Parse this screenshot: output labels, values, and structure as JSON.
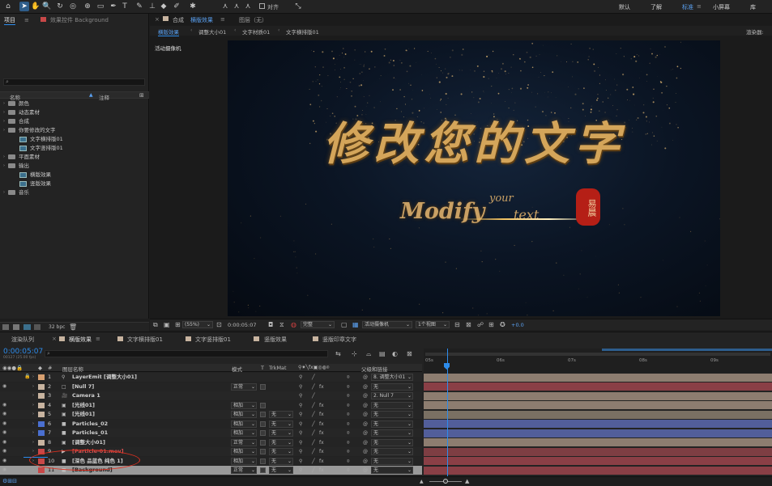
{
  "menu": {
    "workspaces": [
      "默认",
      "了解",
      "标准",
      "小屏幕",
      "库"
    ],
    "active_workspace": "标准",
    "align_label": "对齐"
  },
  "project": {
    "tab_label": "项目",
    "effects_tab_label": "效果控件 Background",
    "search_placeholder": "",
    "col_name": "名称",
    "col_comment": "注释",
    "bpc": "32 bpc",
    "tree": [
      {
        "label": "颜色",
        "type": "folder",
        "indent": 0
      },
      {
        "label": "动态素材",
        "type": "folder",
        "indent": 0
      },
      {
        "label": "合成",
        "type": "folder",
        "indent": 0
      },
      {
        "label": "你要修改的文字",
        "type": "folder",
        "indent": 0
      },
      {
        "label": "文字横排版01",
        "type": "comp",
        "indent": 1
      },
      {
        "label": "文字竖排版01",
        "type": "comp",
        "indent": 1
      },
      {
        "label": "平面素材",
        "type": "folder",
        "indent": 0
      },
      {
        "label": "输出",
        "type": "folder",
        "indent": 0
      },
      {
        "label": "横版效果",
        "type": "comp",
        "indent": 1
      },
      {
        "label": "竖版效果",
        "type": "comp",
        "indent": 1
      },
      {
        "label": "音乐",
        "type": "folder",
        "indent": 0
      }
    ]
  },
  "comp": {
    "header_prefix": "合成",
    "header_name": "横版效果",
    "layer_label": "图层（无）",
    "breadcrumbs": [
      "横版效果",
      "调整大小01",
      "文字材质01",
      "文字横排版01"
    ],
    "renderer_label": "渲染器:",
    "camera_label": "活动摄像机",
    "title_cn": "修改您的文字",
    "title_en": "Modify",
    "title_en2": "your",
    "title_en3": "text",
    "seal_text": "易晨",
    "zoom": "(55%)",
    "timecode": "0:00:05:07",
    "quality": "完整",
    "view_camera": "活动摄像机",
    "view_count": "1个视图",
    "exposure": "+0.0"
  },
  "timeline": {
    "tabs": [
      "渲染队列",
      "横版效果",
      "文字横排版01",
      "文字竖排版01",
      "竖版效果",
      "竖版印章文字"
    ],
    "active_tab": "横版效果",
    "timecode": "0:00:05:07",
    "fps": "00127 (25.00 fps)",
    "col_hash": "#",
    "col_name": "图层名称",
    "col_mode": "模式",
    "col_t": "T",
    "col_trkmat": "TrkMat",
    "col_parent": "父级和链接",
    "ruler": [
      "05s",
      "06s",
      "07s",
      "08s",
      "09s"
    ],
    "layers": [
      {
        "num": "1",
        "name": "LayerEmit [调整大小01]",
        "color": "#d8a070",
        "mode": "",
        "trk": "",
        "parent": "8. 调整大小01",
        "bar": "#8d7d70",
        "icon": "emit"
      },
      {
        "num": "2",
        "name": "[Null 7]",
        "color": "#c8b4a0",
        "mode": "正常",
        "trk": "",
        "parent": "无",
        "bar": "#8a3f46",
        "icon": "null"
      },
      {
        "num": "3",
        "name": "Camera 1",
        "color": "#c8b4a0",
        "mode": "",
        "trk": "",
        "parent": "2. Null 7",
        "bar": "#8d7d70",
        "icon": "camera"
      },
      {
        "num": "4",
        "name": "[光线01]",
        "color": "#c8b4a0",
        "mode": "相加",
        "trk": "",
        "parent": "无",
        "bar": "#8d7d70",
        "icon": "comp"
      },
      {
        "num": "5",
        "name": "[光线01]",
        "color": "#c8b4a0",
        "mode": "相加",
        "trk": "无",
        "parent": "无",
        "bar": "#7a7063",
        "icon": "comp"
      },
      {
        "num": "6",
        "name": "Particles_02",
        "color": "#4a6fd0",
        "mode": "相加",
        "trk": "无",
        "parent": "无",
        "bar": "#525e9a",
        "icon": "solid"
      },
      {
        "num": "7",
        "name": "Particles_01",
        "color": "#4a6fd0",
        "mode": "相加",
        "trk": "无",
        "parent": "无",
        "bar": "#525e9a",
        "icon": "solid"
      },
      {
        "num": "8",
        "name": "[调整大小01]",
        "color": "#c8b4a0",
        "mode": "正常",
        "trk": "无",
        "parent": "无",
        "bar": "#8d7d70",
        "icon": "comp"
      },
      {
        "num": "9",
        "name": "[Particle-01.mov]",
        "color": "#c84848",
        "mode": "相加",
        "trk": "无",
        "parent": "无",
        "bar": "#7e3e43",
        "icon": "mov"
      },
      {
        "num": "10",
        "name": "[深色 品蓝色 纯色 1]",
        "color": "#c84848",
        "mode": "相加",
        "trk": "无",
        "parent": "无",
        "bar": "#8a3f46",
        "icon": "solid"
      },
      {
        "num": "11",
        "name": "[Background]",
        "color": "#c84848",
        "mode": "正常",
        "trk": "无",
        "parent": "无",
        "bar": "#8a3f46",
        "icon": "solid"
      }
    ]
  },
  "colors": {
    "accent": "#2d8ceb",
    "playhead": "#2d8ceb",
    "annotation": "#e03020",
    "gold": "#d4a55a"
  }
}
